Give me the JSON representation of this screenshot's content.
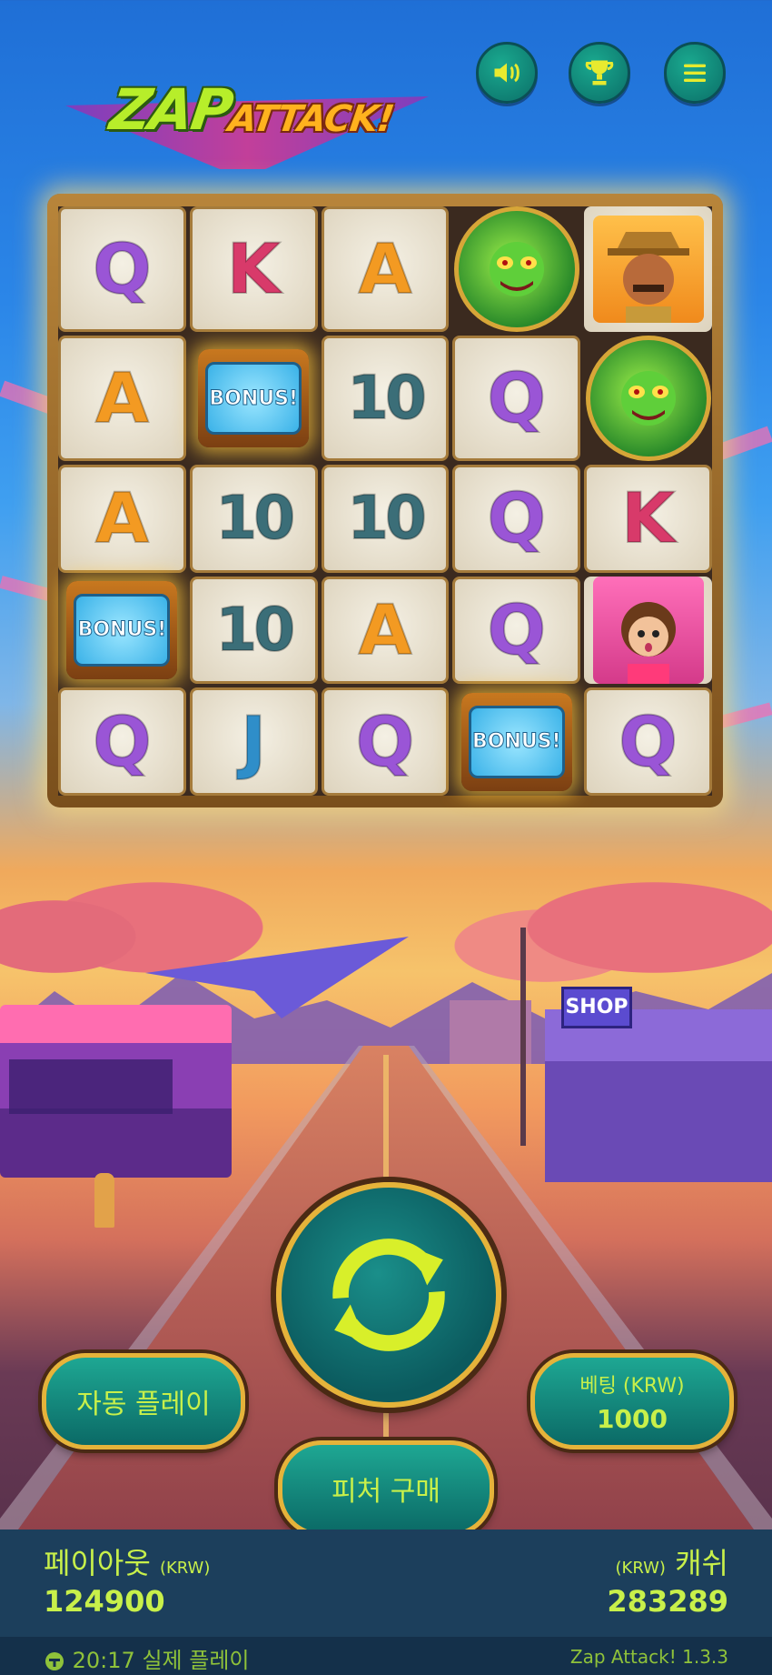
{
  "game": {
    "logo_primary": "ZAP",
    "logo_secondary": "ATTACK!"
  },
  "top_controls": [
    "sound-icon",
    "trophy-icon",
    "menu-icon"
  ],
  "reels": [
    [
      "Q",
      "K",
      "A",
      "alien",
      "sheriff"
    ],
    [
      "A",
      "BONUS",
      "10",
      "Q",
      "alien"
    ],
    [
      "A",
      "10",
      "10",
      "Q",
      "K"
    ],
    [
      "BONUS",
      "10",
      "A",
      "Q",
      "girl"
    ],
    [
      "Q",
      "J",
      "Q",
      "BONUS",
      "Q"
    ]
  ],
  "bonus_text": "BONUS!",
  "controls": {
    "spin_icon": "refresh-icon",
    "autoplay_label": "자동 플레이",
    "feature_buy_label": "피처 구매",
    "bet_label": "베팅 (KRW)",
    "bet_value": "1000"
  },
  "stats": {
    "payout_label": "페이아웃",
    "payout_currency": "(KRW)",
    "payout_value": "124900",
    "cash_currency": "(KRW)",
    "cash_label": "캐쉬",
    "cash_value": "283289"
  },
  "footer": {
    "time": "20:17",
    "mode": "실제 플레이",
    "version": "Zap Attack! 1.3.3"
  },
  "colors": {
    "accent": "#c8f04a",
    "button_teal": "#0b6a66",
    "gold": "#e5b33a"
  }
}
